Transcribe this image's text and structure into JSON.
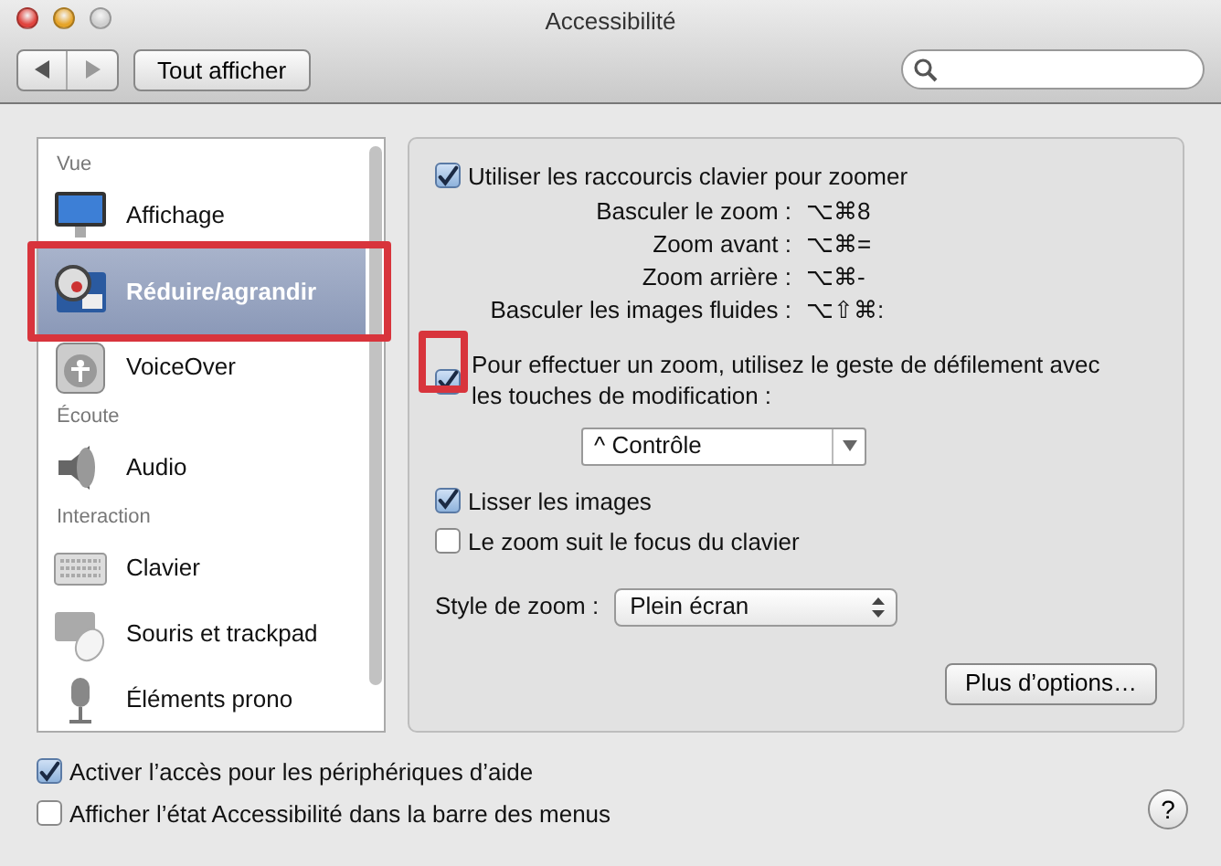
{
  "window": {
    "title": "Accessibilité"
  },
  "toolbar": {
    "show_all": "Tout afficher"
  },
  "sidebar": {
    "items": [
      {
        "kind": "header",
        "label": "Vue"
      },
      {
        "kind": "pane",
        "label": "Affichage",
        "selected": false,
        "highlighted": false
      },
      {
        "kind": "pane",
        "label": "Réduire/agrandir",
        "selected": true,
        "highlighted": true
      },
      {
        "kind": "pane",
        "label": "VoiceOver",
        "selected": false,
        "highlighted": false
      },
      {
        "kind": "header",
        "label": "Écoute"
      },
      {
        "kind": "pane",
        "label": "Audio",
        "selected": false,
        "highlighted": false
      },
      {
        "kind": "header",
        "label": "Interaction"
      },
      {
        "kind": "pane",
        "label": "Clavier",
        "selected": false,
        "highlighted": false
      },
      {
        "kind": "pane",
        "label": "Souris et trackpad",
        "selected": false,
        "highlighted": false
      },
      {
        "kind": "pane",
        "label": "Éléments prono",
        "selected": false,
        "highlighted": false
      }
    ]
  },
  "panel": {
    "shortcuts_checkbox": {
      "label": "Utiliser les raccourcis clavier pour zoomer",
      "checked": true
    },
    "shortcuts": [
      {
        "label": "Basculer le zoom :",
        "keys": "⌥⌘8"
      },
      {
        "label": "Zoom avant :",
        "keys": "⌥⌘="
      },
      {
        "label": "Zoom arrière :",
        "keys": "⌥⌘-"
      },
      {
        "label": "Basculer les images fluides :",
        "keys": "⌥⇧⌘:"
      }
    ],
    "scroll_gesture": {
      "label": "Pour effectuer un zoom, utilisez le geste de défilement avec les touches de modification :",
      "checked": true,
      "highlighted": true
    },
    "modifier_select": {
      "value": "^ Contrôle"
    },
    "options": [
      {
        "label": "Lisser les images",
        "checked": true
      },
      {
        "label": "Le zoom suit le focus du clavier",
        "checked": false
      }
    ],
    "zoom_style": {
      "label": "Style de zoom :",
      "value": "Plein écran"
    },
    "more_button": "Plus d’options…"
  },
  "footer": {
    "checkboxes": [
      {
        "label": "Activer l’accès pour les périphériques d’aide",
        "checked": true
      },
      {
        "label": "Afficher l’état Accessibilité dans la barre des menus",
        "checked": false
      }
    ],
    "help": "?"
  }
}
